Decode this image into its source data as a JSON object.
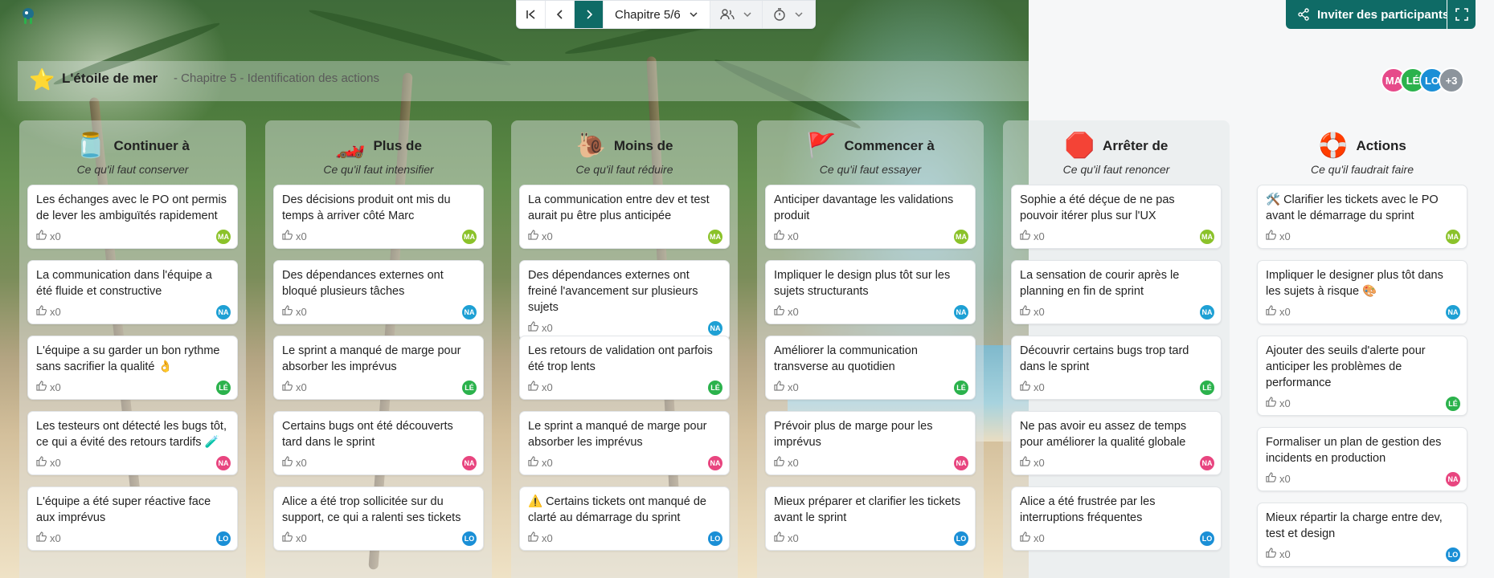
{
  "app": {
    "logo": "octopus-logo"
  },
  "toolbar": {
    "chapter_label": "Chapitre 5/6",
    "buttons": [
      "first-page-icon",
      "prev-icon",
      "next-icon"
    ],
    "participants_icon": "people-icon",
    "timer_icon": "timer-icon"
  },
  "actions": {
    "invite_label": "Inviter des participants",
    "fullscreen_icon": "expand-icon"
  },
  "header": {
    "emoji": "⭐",
    "title": "L'étoile de mer",
    "subtitle": "- Chapitre 5 - Identification des actions"
  },
  "participants": [
    {
      "initials": "MA",
      "color": "#e64a8a"
    },
    {
      "initials": "LÉ",
      "color": "#2bb24c"
    },
    {
      "initials": "LO",
      "color": "#1a8fd6"
    },
    {
      "initials": "+3",
      "color": "#8c949c"
    }
  ],
  "avatar_colors": {
    "MA": "#8bc22a",
    "NA": "#1ea0d4",
    "LÉ": "#2bb24c",
    "NA2": "#e8457f",
    "LO": "#1a8fd6"
  },
  "like_label": "x0",
  "columns": [
    {
      "emoji": "🫙",
      "title": "Continuer à",
      "subtitle": "Ce qu'il faut conserver",
      "cards": [
        {
          "text": "Les échanges avec le PO ont permis de lever les ambiguïtés rapidement",
          "author": "MA",
          "color": "#8bc22a"
        },
        {
          "text": "La communication dans l'équipe a été fluide et constructive",
          "author": "NA",
          "color": "#1ea0d4"
        },
        {
          "text": "L'équipe a su garder un bon rythme sans sacrifier la qualité 👌",
          "author": "LÉ",
          "color": "#2bb24c"
        },
        {
          "text": "Les testeurs ont détecté les bugs tôt, ce qui a évité des retours tardifs 🧪",
          "author": "NA",
          "color": "#e8457f"
        },
        {
          "text": "L'équipe a été super réactive face aux imprévus",
          "author": "LO",
          "color": "#1a8fd6"
        }
      ]
    },
    {
      "emoji": "🏎️",
      "title": "Plus de",
      "subtitle": "Ce qu'il faut intensifier",
      "cards": [
        {
          "text": "Des décisions produit ont mis du temps à arriver côté Marc",
          "author": "MA",
          "color": "#8bc22a"
        },
        {
          "text": "Des dépendances externes ont bloqué plusieurs tâches",
          "author": "NA",
          "color": "#1ea0d4"
        },
        {
          "text": "Le sprint a manqué de marge pour absorber les imprévus",
          "author": "LÉ",
          "color": "#2bb24c"
        },
        {
          "text": "Certains bugs ont été découverts tard dans le sprint",
          "author": "NA",
          "color": "#e8457f"
        },
        {
          "text": "Alice a été trop sollicitée sur du support, ce qui a ralenti ses tickets",
          "author": "LO",
          "color": "#1a8fd6"
        }
      ]
    },
    {
      "emoji": "🐌",
      "title": "Moins de",
      "subtitle": "Ce qu'il faut réduire",
      "cards": [
        {
          "text": "La communication entre dev et test aurait pu être plus anticipée",
          "author": "MA",
          "color": "#8bc22a"
        },
        {
          "text": "Des dépendances externes ont freiné l'avancement sur plusieurs sujets",
          "author": "NA",
          "color": "#1ea0d4"
        },
        {
          "text": "Les retours de validation ont parfois été trop lents",
          "author": "LÉ",
          "color": "#2bb24c"
        },
        {
          "text": "Le sprint a manqué de marge pour absorber les imprévus",
          "author": "NA",
          "color": "#e8457f"
        },
        {
          "text": "⚠️ Certains tickets ont manqué de clarté au démarrage du sprint",
          "author": "LO",
          "color": "#1a8fd6"
        }
      ]
    },
    {
      "emoji": "🚩",
      "title": "Commencer à",
      "subtitle": "Ce qu'il faut essayer",
      "cards": [
        {
          "text": "Anticiper davantage les validations produit",
          "author": "MA",
          "color": "#8bc22a"
        },
        {
          "text": "Impliquer le design plus tôt sur les sujets structurants",
          "author": "NA",
          "color": "#1ea0d4"
        },
        {
          "text": "Améliorer la communication transverse au quotidien",
          "author": "LÉ",
          "color": "#2bb24c"
        },
        {
          "text": "Prévoir plus de marge pour les imprévus",
          "author": "NA",
          "color": "#e8457f"
        },
        {
          "text": "Mieux préparer et clarifier les tickets avant le sprint",
          "author": "LO",
          "color": "#1a8fd6"
        }
      ]
    },
    {
      "emoji": "🛑",
      "title": "Arrêter de",
      "subtitle": "Ce qu'il faut renoncer",
      "cards": [
        {
          "text": "Sophie a été déçue de ne pas pouvoir itérer plus sur l'UX",
          "author": "MA",
          "color": "#8bc22a"
        },
        {
          "text": "La sensation de courir après le planning en fin de sprint",
          "author": "NA",
          "color": "#1ea0d4"
        },
        {
          "text": "Découvrir certains bugs trop tard dans le sprint",
          "author": "LÉ",
          "color": "#2bb24c"
        },
        {
          "text": "Ne pas avoir eu assez de temps pour améliorer la qualité globale",
          "author": "NA",
          "color": "#e8457f"
        },
        {
          "text": "Alice a été frustrée par les interruptions fréquentes",
          "author": "LO",
          "color": "#1a8fd6"
        }
      ]
    },
    {
      "emoji": "🛟",
      "title": "Actions",
      "subtitle": "Ce qu'il faudrait faire",
      "cards": [
        {
          "text": "🛠️ Clarifier les tickets avec le PO avant le démarrage du sprint",
          "author": "MA",
          "color": "#8bc22a"
        },
        {
          "text": "Impliquer le designer plus tôt dans les sujets à risque 🎨",
          "author": "NA",
          "color": "#1ea0d4"
        },
        {
          "text": "Ajouter des seuils d'alerte pour anticiper les problèmes de performance",
          "author": "LÉ",
          "color": "#2bb24c"
        },
        {
          "text": "Formaliser un plan de gestion des incidents en production",
          "author": "NA",
          "color": "#e8457f"
        },
        {
          "text": "Mieux répartir la charge entre dev, test et design",
          "author": "LO",
          "color": "#1a8fd6"
        }
      ]
    }
  ]
}
